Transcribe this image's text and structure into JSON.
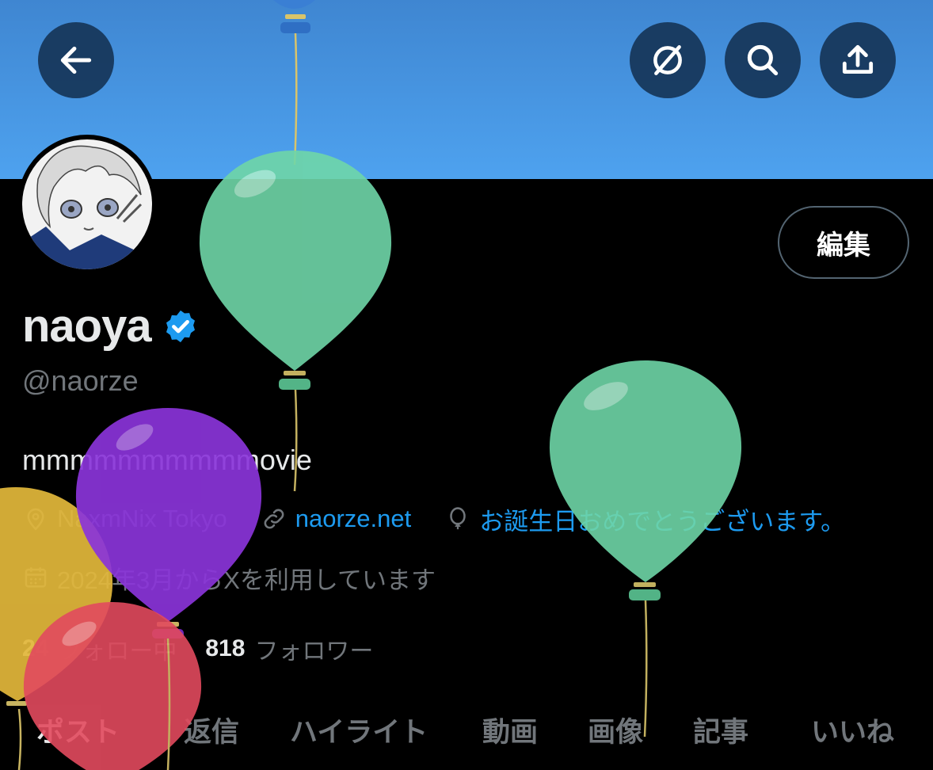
{
  "header": {
    "back_icon": "arrow-left-icon",
    "grok_icon": "slash-circle-icon",
    "search_icon": "search-icon",
    "share_icon": "share-icon",
    "banner_color": "#4a9ae8"
  },
  "profile": {
    "edit_label": "編集",
    "display_name": "naoya",
    "handle": "@naorze",
    "bio": "mmmmmmmmmmovie",
    "location": "NaxmNix Tokyo",
    "website": "naorze.net",
    "birthday": "お誕生日おめでとうございます。",
    "joined": "2024年3月からXを利用しています",
    "following_count": "24",
    "following_label": "フォロー中",
    "followers_count": "818",
    "followers_label": "フォロワー",
    "verified_color": "#1d9bf0"
  },
  "tabs": [
    "ポスト",
    "返信",
    "ハイライト",
    "動画",
    "画像",
    "記事",
    "いいね"
  ],
  "colors": {
    "balloon_green": "#6fd6a8",
    "balloon_purple": "#8a34d9",
    "balloon_yellow": "#e3b83b",
    "balloon_red": "#e24a5e",
    "link": "#1d9bf0"
  }
}
